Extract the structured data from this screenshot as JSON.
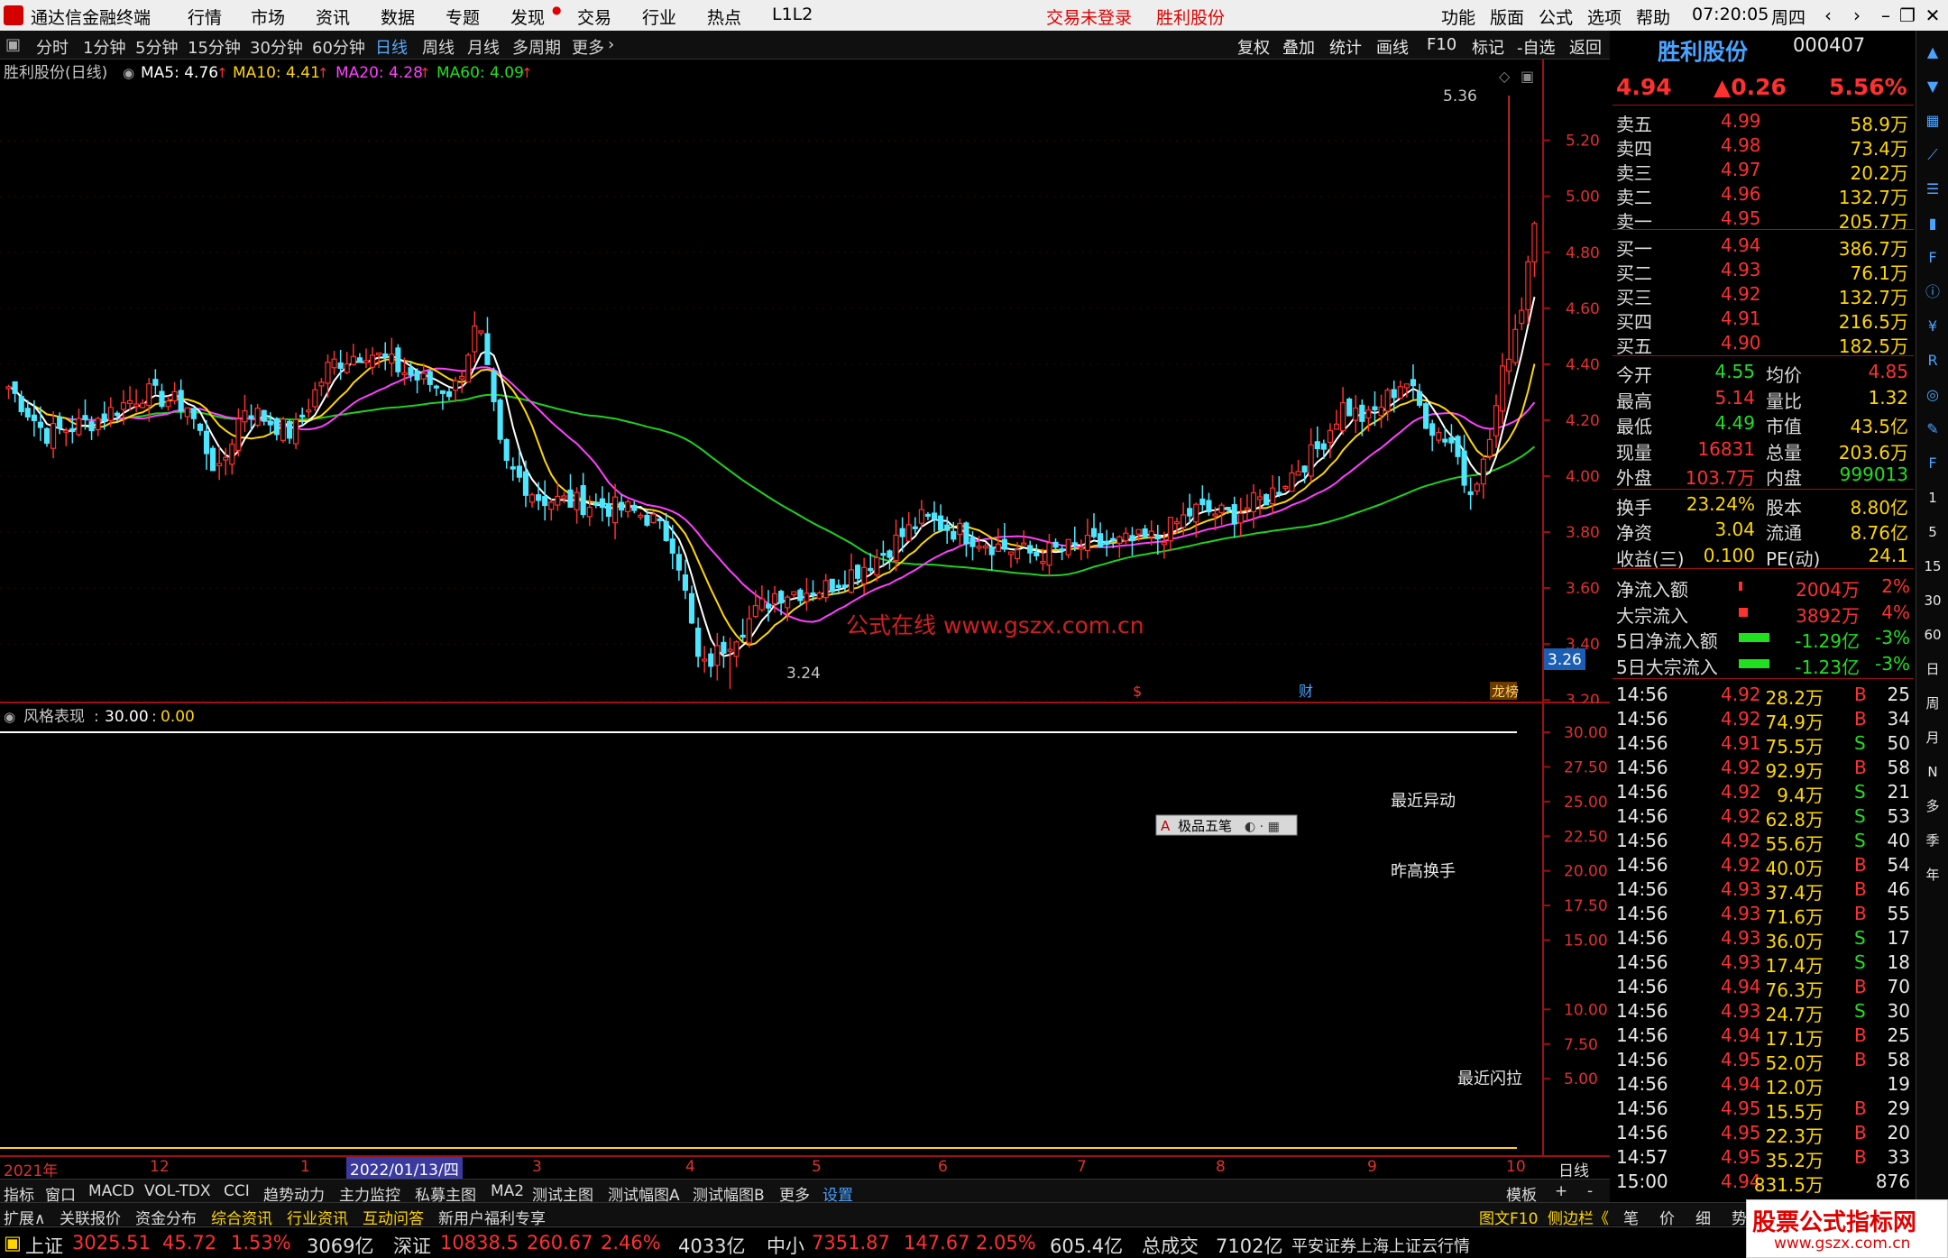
{
  "app": {
    "title": "通达信金融终端",
    "menus": [
      "行情",
      "市场",
      "资讯",
      "数据",
      "专题",
      "发现",
      "交易",
      "行业",
      "热点",
      "L1L2"
    ],
    "login_status": "交易未登录",
    "stock_title": "胜利股份",
    "right_menus": [
      "功能",
      "版面",
      "公式",
      "选项",
      "帮助"
    ],
    "clock": "07:20:05",
    "weekday": "周四"
  },
  "toolbar": {
    "periods": [
      "分时",
      "1分钟",
      "5分钟",
      "15分钟",
      "30分钟",
      "60分钟",
      "日线",
      "周线",
      "月线",
      "多周期",
      "更多"
    ],
    "active": "日线",
    "right_buttons": [
      "复权",
      "叠加",
      "统计",
      "画线",
      "F10",
      "标记",
      "-自选",
      "返回"
    ]
  },
  "main_chart": {
    "legend_name": "胜利股份(日线)",
    "ma5": "MA5: 4.76",
    "ma10": "MA10: 4.41",
    "ma20": "MA20: 4.28",
    "ma60": "MA60: 4.09",
    "high_label": "5.36",
    "low_label": "3.24",
    "price_tag": "3.26",
    "watermark": "公式在线 www.gszx.com.cn",
    "markers": [
      "$",
      "财",
      "龙榜"
    ],
    "y_ticks": [
      "5.20",
      "5.00",
      "4.80",
      "4.60",
      "4.40",
      "4.20",
      "4.00",
      "3.80",
      "3.60",
      "3.40",
      "3.20"
    ]
  },
  "indicator": {
    "name": "风格表现",
    "value_a": "30.00",
    "value_b": "0.00",
    "y_ticks": [
      "30.00",
      "27.50",
      "25.00",
      "22.50",
      "20.00",
      "17.50",
      "15.00",
      "10.00",
      "7.50",
      "5.00"
    ],
    "labels": [
      "最近异动",
      "昨高换手",
      "最近闪拉"
    ],
    "ime": "极品五笔"
  },
  "xaxis": {
    "labels": [
      "2021年",
      "12",
      "1",
      "2022/01/13/四",
      "3",
      "4",
      "5",
      "6",
      "7",
      "8",
      "9",
      "10"
    ],
    "period": "日线"
  },
  "chart_data": {
    "type": "candlestick",
    "title": "胜利股份(日线)",
    "ylim": [
      3.2,
      5.36
    ],
    "y_ticks": [
      3.2,
      3.4,
      3.6,
      3.8,
      4.0,
      4.2,
      4.4,
      4.6,
      4.8,
      5.0,
      5.2
    ],
    "high": 5.36,
    "low": 3.24,
    "last_ma": {
      "MA5": 4.76,
      "MA10": 4.41,
      "MA20": 4.28,
      "MA60": 4.09
    }
  },
  "quote": {
    "name": "胜利股份",
    "code": "000407",
    "price": "4.94",
    "change": "▲0.26",
    "pct": "5.56%",
    "asks": [
      [
        "卖五",
        "4.99",
        "58.9万"
      ],
      [
        "卖四",
        "4.98",
        "73.4万"
      ],
      [
        "卖三",
        "4.97",
        "20.2万"
      ],
      [
        "卖二",
        "4.96",
        "132.7万"
      ],
      [
        "卖一",
        "4.95",
        "205.7万"
      ]
    ],
    "bids": [
      [
        "买一",
        "4.94",
        "386.7万"
      ],
      [
        "买二",
        "4.93",
        "76.1万"
      ],
      [
        "买三",
        "4.92",
        "132.7万"
      ],
      [
        "买四",
        "4.91",
        "216.5万"
      ],
      [
        "买五",
        "4.90",
        "182.5万"
      ]
    ],
    "stats": [
      [
        "今开",
        "4.55",
        "均价",
        "4.85"
      ],
      [
        "最高",
        "5.14",
        "量比",
        "1.32"
      ],
      [
        "最低",
        "4.49",
        "市值",
        "43.5亿"
      ],
      [
        "现量",
        "16831",
        "总量",
        "203.6万"
      ],
      [
        "外盘",
        "103.7万",
        "内盘",
        "999013"
      ],
      [
        "换手",
        "23.24%",
        "股本",
        "8.80亿"
      ],
      [
        "净资",
        "3.04",
        "流通",
        "8.76亿"
      ],
      [
        "收益(三)",
        "0.100",
        "PE(动)",
        "24.1"
      ]
    ],
    "flows": [
      [
        "净流入额",
        "2004万",
        "2%"
      ],
      [
        "大宗流入",
        "3892万",
        "4%"
      ],
      [
        "5日净流入额",
        "-1.29亿",
        "-3%"
      ],
      [
        "5日大宗流入",
        "-1.23亿",
        "-3%"
      ]
    ],
    "ticks": [
      [
        "14:56",
        "4.92",
        "28.2万",
        "B",
        "25"
      ],
      [
        "14:56",
        "4.92",
        "74.9万",
        "B",
        "34"
      ],
      [
        "14:56",
        "4.91",
        "75.5万",
        "S",
        "50"
      ],
      [
        "14:56",
        "4.92",
        "92.9万",
        "B",
        "58"
      ],
      [
        "14:56",
        "4.92",
        "9.4万",
        "S",
        "21"
      ],
      [
        "14:56",
        "4.92",
        "62.8万",
        "S",
        "53"
      ],
      [
        "14:56",
        "4.92",
        "55.6万",
        "S",
        "40"
      ],
      [
        "14:56",
        "4.92",
        "40.0万",
        "B",
        "54"
      ],
      [
        "14:56",
        "4.93",
        "37.4万",
        "B",
        "46"
      ],
      [
        "14:56",
        "4.93",
        "71.6万",
        "B",
        "55"
      ],
      [
        "14:56",
        "4.93",
        "36.0万",
        "S",
        "17"
      ],
      [
        "14:56",
        "4.93",
        "17.4万",
        "S",
        "18"
      ],
      [
        "14:56",
        "4.94",
        "76.3万",
        "B",
        "70"
      ],
      [
        "14:56",
        "4.93",
        "24.7万",
        "S",
        "30"
      ],
      [
        "14:56",
        "4.94",
        "17.1万",
        "B",
        "25"
      ],
      [
        "14:56",
        "4.95",
        "52.0万",
        "B",
        "58"
      ],
      [
        "14:56",
        "4.94",
        "12.0万",
        "",
        "19"
      ],
      [
        "14:56",
        "4.95",
        "15.5万",
        "B",
        "29"
      ],
      [
        "14:56",
        "4.95",
        "22.3万",
        "B",
        "20"
      ],
      [
        "14:57",
        "4.95",
        "35.2万",
        "B",
        "33"
      ],
      [
        "15:00",
        "4.94",
        "831.5万",
        "",
        "876"
      ]
    ]
  },
  "tabs": {
    "row1": [
      "指标",
      "窗口",
      "MACD",
      "VOL-TDX",
      "CCI",
      "趋势动力",
      "主力监控",
      "私募主图",
      "MA2",
      "测试主图",
      "测试幅图A",
      "测试幅图B",
      "更多",
      "设置"
    ],
    "row1_right": [
      "模板",
      "+",
      "-"
    ],
    "row2": [
      "扩展∧",
      "关联报价",
      "资金分布",
      "综合资讯",
      "行业资讯",
      "互动问答",
      "新用户福利专享"
    ],
    "row2_right": [
      "图文F10",
      "侧边栏《",
      "笔",
      "价",
      "细",
      "势"
    ]
  },
  "status": {
    "sh_name": "上证",
    "sh": "3025.51",
    "sh_chg": "45.72",
    "sh_pct": "1.53%",
    "sh_amt": "3069亿",
    "sz_name": "深证",
    "sz": "10838.5",
    "sz_chg": "260.67",
    "sz_pct": "2.46%",
    "sz_amt": "4033亿",
    "zx_name": "中小",
    "zx": "7351.87",
    "zx_chg": "147.67",
    "zx_pct": "2.05%",
    "zx_amt": "605.4亿",
    "total_label": "总成交",
    "total": "7102亿",
    "broker": "平安证券上海上证云行情",
    "brand": "股票公式指标网",
    "brand_url": "www.gszx.com.cn"
  },
  "sidebar_icons": [
    "up-arrow-icon",
    "down-arrow-icon",
    "grid-icon",
    "chart-icon",
    "list-icon",
    "candle-icon",
    "f10-icon",
    "info-icon",
    "money-icon",
    "rsi-icon",
    "compass-icon",
    "pen-icon",
    "fs-icon",
    "1min-icon",
    "5min-icon",
    "15min-icon",
    "30min-icon",
    "60min-icon",
    "day-icon",
    "week-icon",
    "month-icon",
    "n-icon",
    "multi-icon",
    "season-icon",
    "year-icon"
  ],
  "sidebar_labels": [
    "1",
    "5",
    "15",
    "30",
    "60",
    "日",
    "周",
    "月",
    "N",
    "多",
    "季",
    "年",
    "RSI",
    "FS"
  ]
}
